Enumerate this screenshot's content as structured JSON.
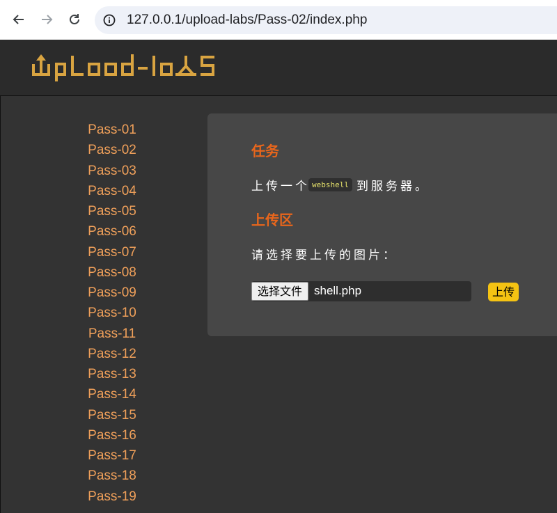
{
  "browser": {
    "url": "127.0.0.1/upload-labs/Pass-02/index.php"
  },
  "header": {
    "logo_text": "UpLood-loAS",
    "logo_color": "#d9a441"
  },
  "sidebar": {
    "items": [
      {
        "label": "Pass-01"
      },
      {
        "label": "Pass-02"
      },
      {
        "label": "Pass-03"
      },
      {
        "label": "Pass-04"
      },
      {
        "label": "Pass-05"
      },
      {
        "label": "Pass-06"
      },
      {
        "label": "Pass-07"
      },
      {
        "label": "Pass-08"
      },
      {
        "label": "Pass-09"
      },
      {
        "label": "Pass-10"
      },
      {
        "label": "Pass-11"
      },
      {
        "label": "Pass-12"
      },
      {
        "label": "Pass-13"
      },
      {
        "label": "Pass-14"
      },
      {
        "label": "Pass-15"
      },
      {
        "label": "Pass-16"
      },
      {
        "label": "Pass-17"
      },
      {
        "label": "Pass-18"
      },
      {
        "label": "Pass-19"
      }
    ]
  },
  "main": {
    "task_title": "任务",
    "task_prefix": "上传一个",
    "task_code": "webshell",
    "task_suffix": "到服务器。",
    "upload_title": "上传区",
    "prompt": "请选择要上传的图片：",
    "choose_file_label": "选择文件",
    "file_name": "shell.php",
    "upload_label": "上传"
  },
  "colors": {
    "accent_orange": "#e8661c",
    "link_orange": "#f0a05a",
    "button_yellow": "#f5c313"
  }
}
